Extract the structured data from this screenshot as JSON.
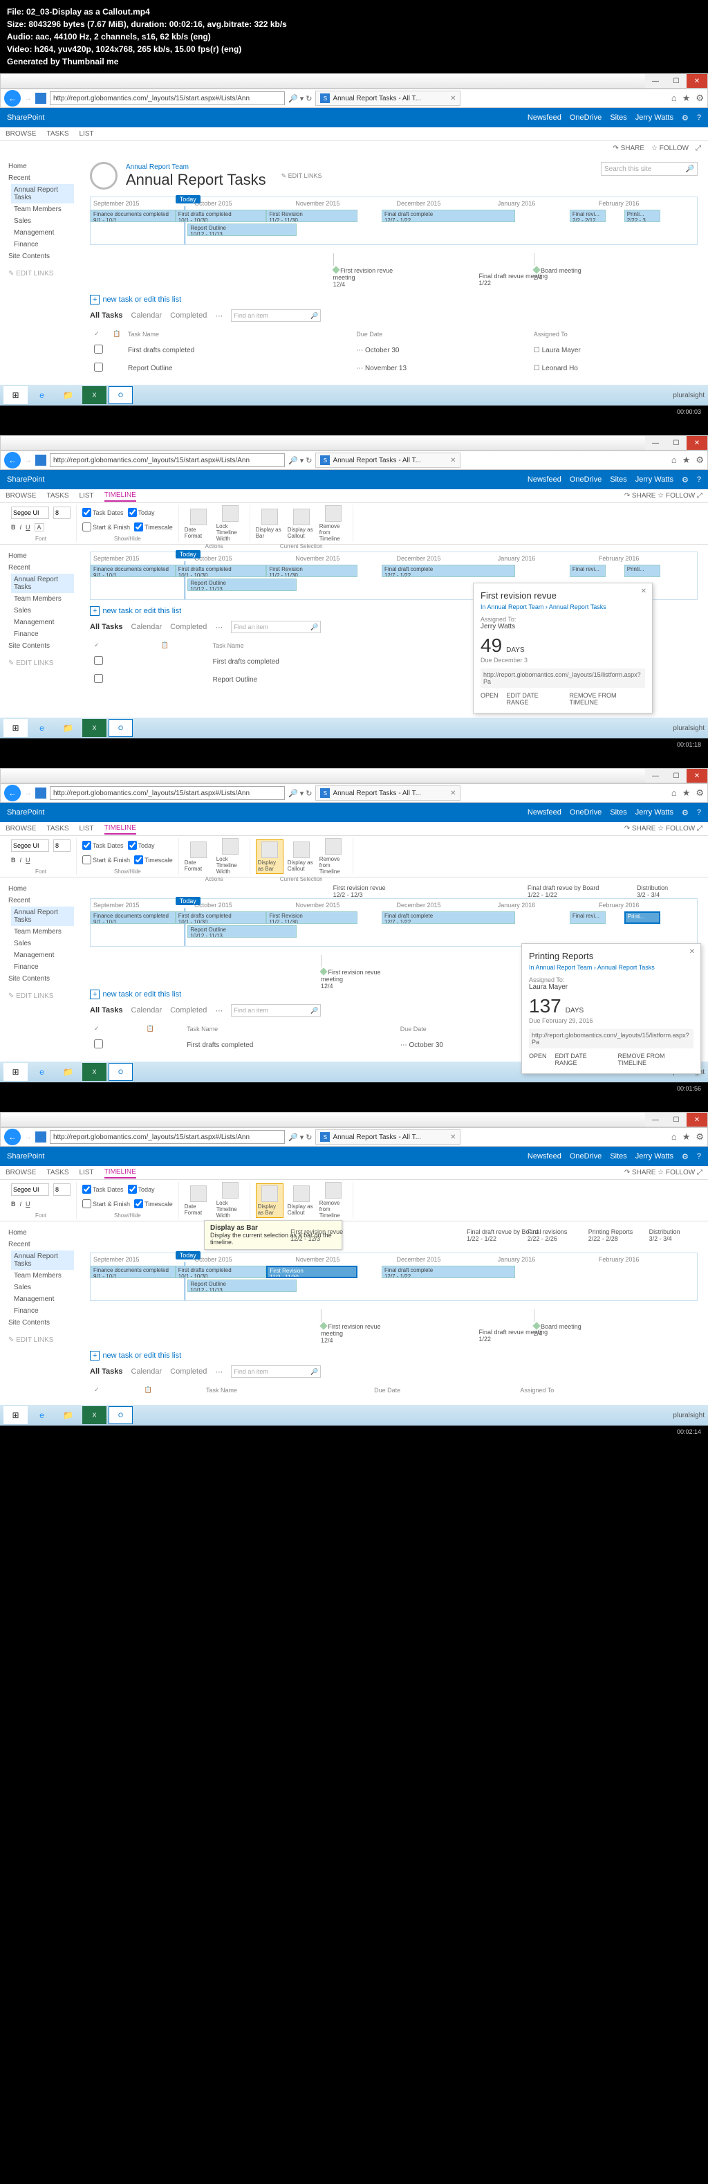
{
  "meta": {
    "file": "File: 02_03-Display as a Callout.mp4",
    "size": "Size: 8043296 bytes (7.67 MiB), duration: 00:02:16, avg.bitrate: 322 kb/s",
    "audio": "Audio: aac, 44100 Hz, 2 channels, s16, 62 kb/s (eng)",
    "video": "Video: h264, yuv420p, 1024x768, 265 kb/s, 15.00 fps(r) (eng)",
    "gen": "Generated by Thumbnail me"
  },
  "url": "http://report.globomantics.com/_layouts/15/start.aspx#/Lists/Ann",
  "tab_title": "Annual Report Tasks - All T...",
  "sp_brand": "SharePoint",
  "sp_top_links": {
    "newsfeed": "Newsfeed",
    "onedrive": "OneDrive",
    "sites": "Sites",
    "user": "Jerry Watts"
  },
  "share": {
    "share": "SHARE",
    "follow": "FOLLOW"
  },
  "ribbon_tabs": {
    "browse": "BROWSE",
    "tasks": "TASKS",
    "list": "LIST",
    "timeline": "TIMELINE"
  },
  "breadcrumb": "Annual Report Team",
  "page_title": "Annual Report Tasks",
  "edit_links": "EDIT LINKS",
  "search_ph": "Search this site",
  "nav": {
    "home": "Home",
    "recent": "Recent",
    "art": "Annual Report Tasks",
    "tm": "Team Members",
    "sales": "Sales",
    "mgmt": "Management",
    "fin": "Finance",
    "sc": "Site Contents",
    "el": "EDIT LINKS"
  },
  "months": {
    "sep": "September 2015",
    "oct": "October 2015",
    "nov": "November 2015",
    "dec": "December 2015",
    "jan": "January 2016",
    "feb": "February 2016"
  },
  "today": "Today",
  "bars": {
    "finance": "Finance documents completed",
    "finance_d": "9/1 - 10/1",
    "drafts": "First drafts completed",
    "drafts_d": "10/1 - 10/30",
    "first_rev": "First Revision",
    "first_rev_d": "11/2 - 11/30",
    "final_draft": "Final draft complete",
    "final_draft_d": "12/7 - 1/22",
    "final_rev": "Final revi...",
    "final_rev_d": "2/2 - 2/12",
    "print": "Printi...",
    "print_d": "2/22 - 3",
    "outline": "Report Outline",
    "outline_d": "10/12 - 11/13",
    "dist": "Distribution",
    "dist_d": "3/2 - 3/4"
  },
  "callouts": {
    "frr": {
      "t": "First revision revue",
      "sub": "meeting",
      "d": "12/4"
    },
    "bm": {
      "t": "Board meeting",
      "d": "2/4"
    },
    "fdr": {
      "t": "Final draft revue meeting",
      "d": "1/22"
    },
    "fr2": {
      "t": "First revision revue",
      "d": "12/2 - 12/3"
    },
    "fdb": {
      "t": "Final draft revue by Board",
      "d": "1/22 - 1/22"
    },
    "pr": {
      "t": "Printing Reports",
      "d": "2/22 - 2/28"
    },
    "frtop": {
      "t": "Final revisions",
      "d": "2/22 - 2/26"
    }
  },
  "newtask": "new task or edit this list",
  "list_tabs": {
    "all": "All Tasks",
    "cal": "Calendar",
    "comp": "Completed"
  },
  "find_ph": "Find an item",
  "cols": {
    "task": "Task Name",
    "due": "Due Date",
    "assigned": "Assigned To"
  },
  "rows": {
    "r1": {
      "name": "First drafts completed",
      "due": "October 30",
      "who": "Laura Mayer"
    },
    "r2": {
      "name": "Report Outline",
      "due": "November 13",
      "who": "Leonard Ho"
    }
  },
  "ps": "pluralsight",
  "ribbon": {
    "font": "Segoe UI",
    "size": "8",
    "task_dates": "Task Dates",
    "today_ck": "Today",
    "start_finish": "Start & Finish",
    "timescale": "Timescale",
    "date_format": "Date Format",
    "lock_width": "Lock Timeline Width",
    "display_bar": "Display as Bar",
    "display_callout": "Display as Callout",
    "remove": "Remove from Timeline",
    "g_font": "Font",
    "g_show": "Show/Hide",
    "g_actions": "Actions",
    "g_cs": "Current Selection"
  },
  "popup1": {
    "title": "First revision revue",
    "bc": "In Annual Report Team › Annual Report Tasks",
    "assigned_lbl": "Assigned To:",
    "assigned": "Jerry Watts",
    "num": "49",
    "days": "DAYS",
    "due": "Due December 3",
    "url": "http://report.globomantics.com/_layouts/15/listform.aspx?Pa",
    "open": "OPEN",
    "edit": "EDIT DATE RANGE",
    "remove": "REMOVE FROM TIMELINE"
  },
  "popup2": {
    "title": "Printing Reports",
    "bc": "In Annual Report Team › Annual Report Tasks",
    "assigned_lbl": "Assigned To:",
    "assigned": "Laura Mayer",
    "num": "137",
    "days": "DAYS",
    "due": "Due February 29, 2016",
    "url": "http://report.globomantics.com/_layouts/15/listform.aspx?Pa",
    "open": "OPEN",
    "edit": "EDIT DATE RANGE",
    "remove": "REMOVE FROM TIMELINE"
  },
  "tooltip": {
    "title": "Display as Bar",
    "text": "Display the current selection as a bar on the timeline."
  },
  "ts": {
    "t1": "00:00:03",
    "t2": "00:01:18",
    "t3": "00:01:56",
    "t4": "00:02:14"
  }
}
